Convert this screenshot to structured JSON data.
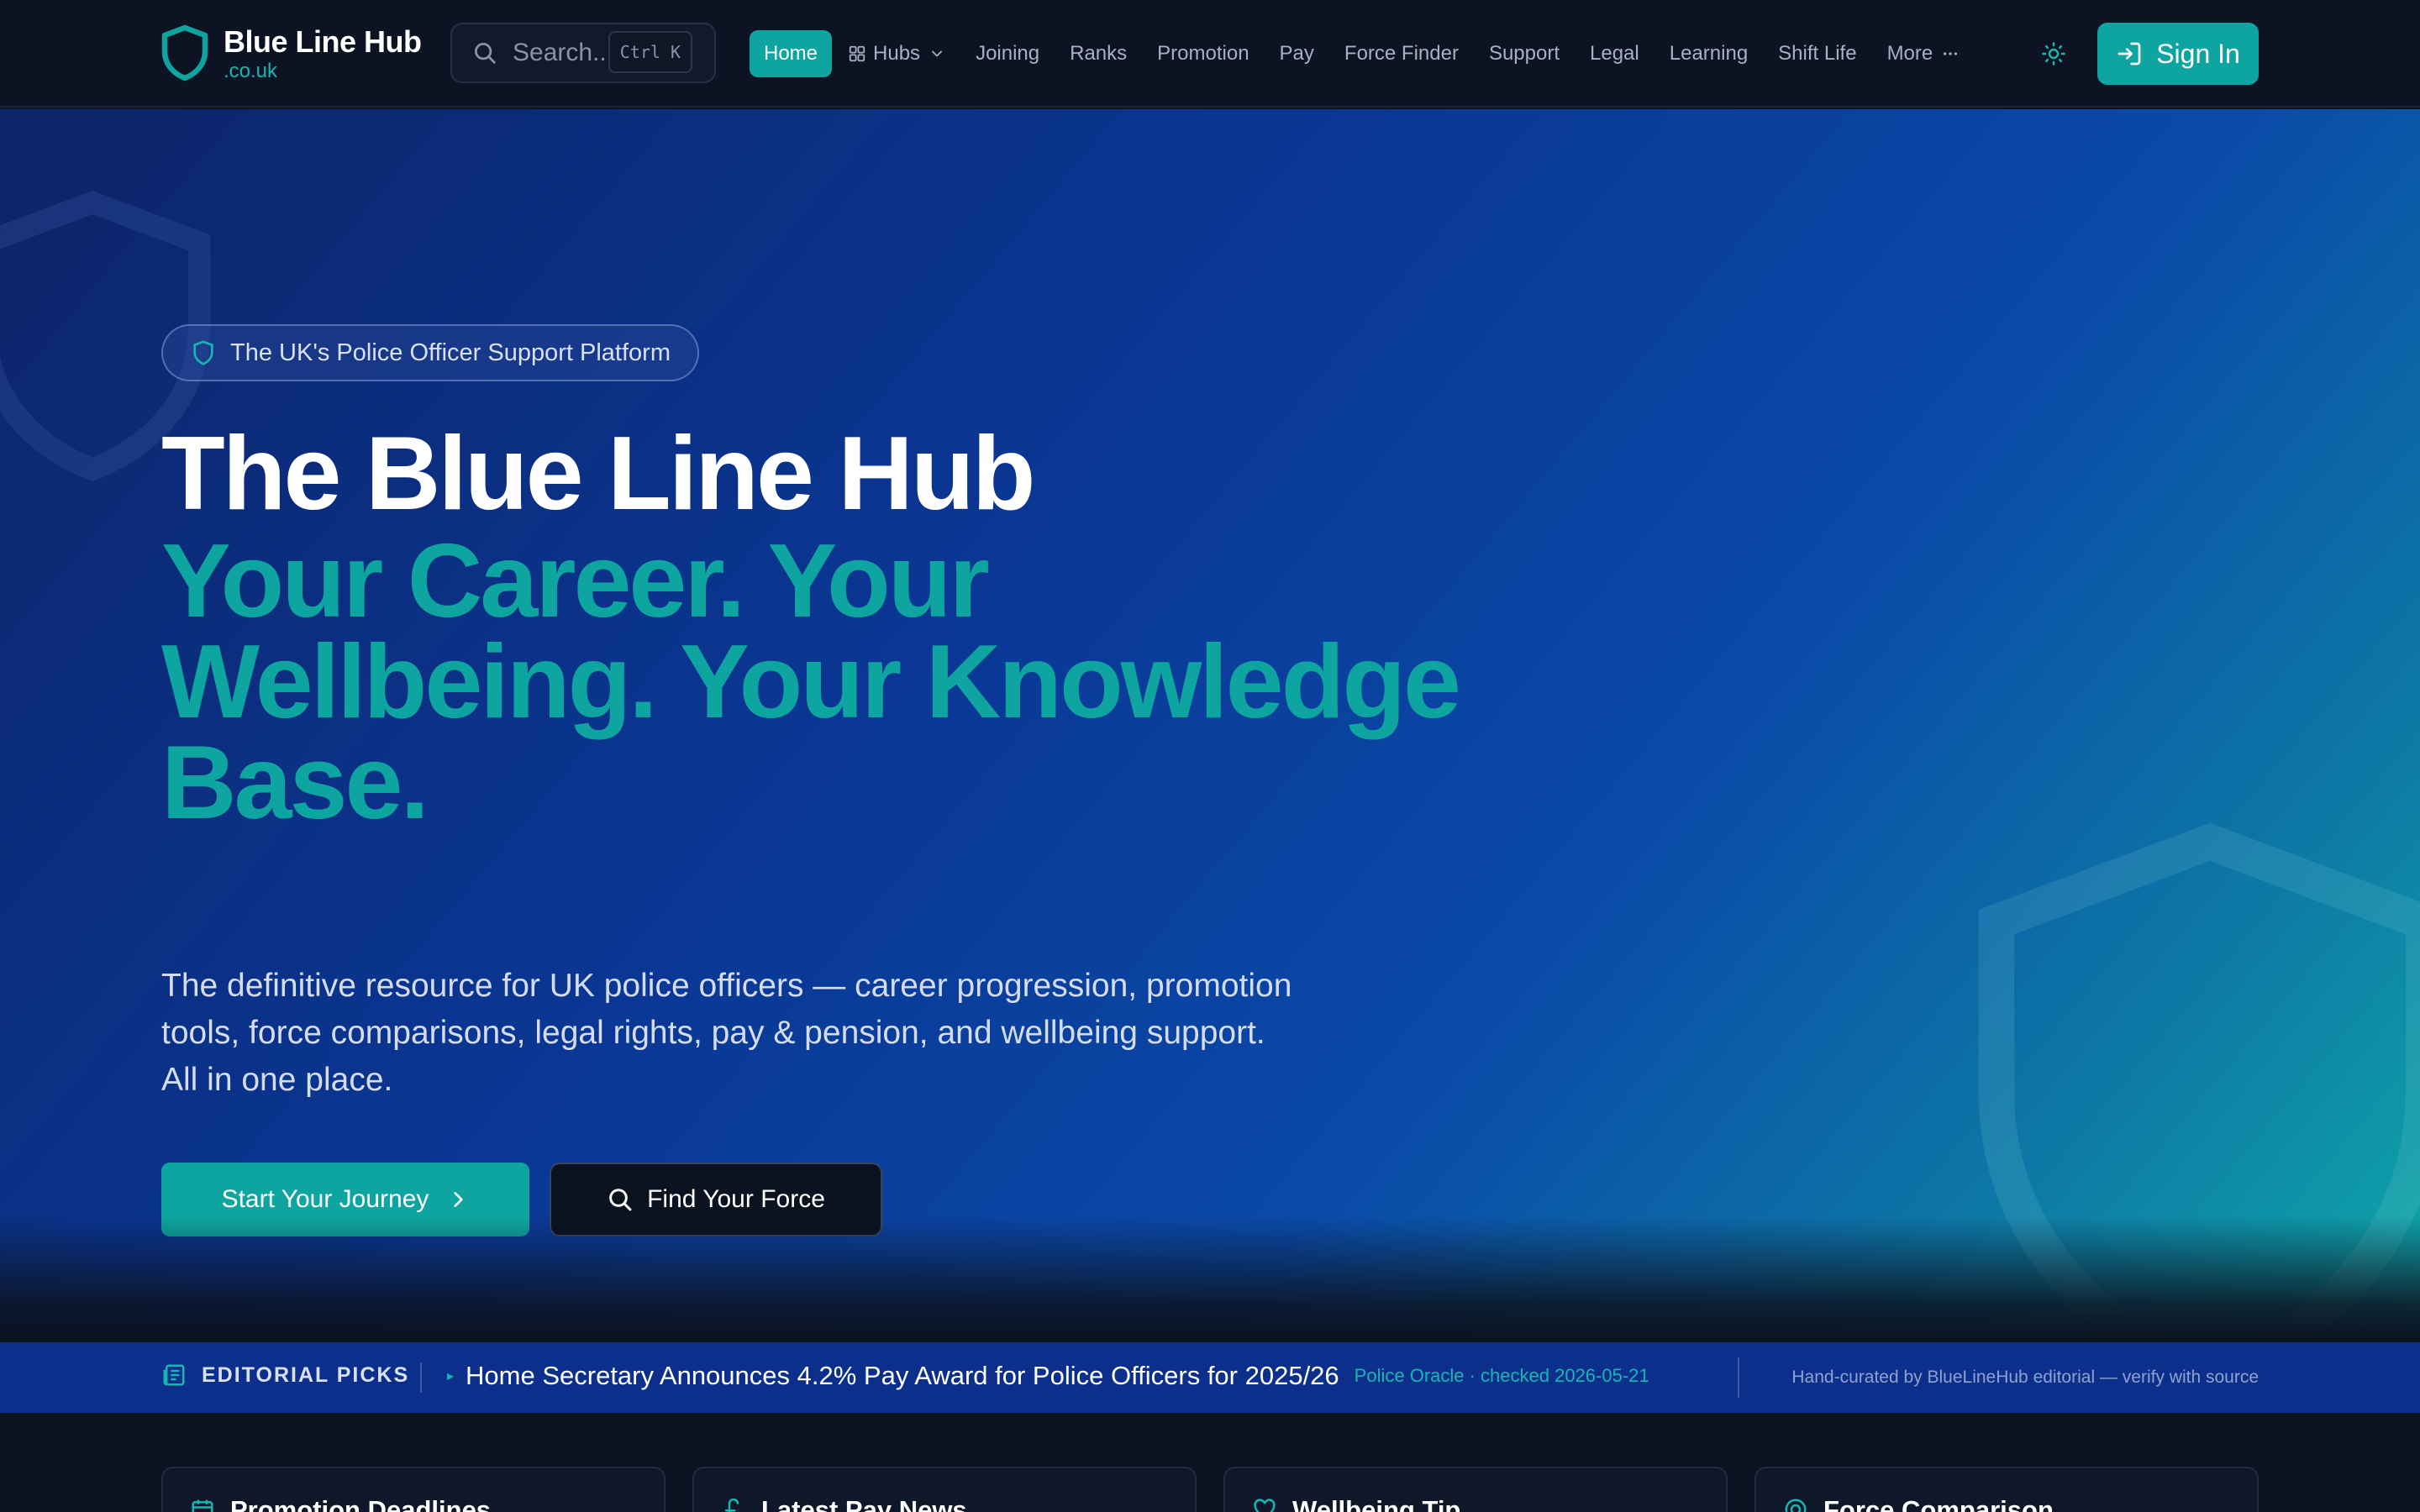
{
  "brand": {
    "name": "Blue Line Hub",
    "domain": ".co.uk",
    "accent": "#0ea5a0"
  },
  "search": {
    "placeholder": "Search...",
    "shortcut": "Ctrl K"
  },
  "nav": {
    "items": [
      {
        "label": "Home",
        "active": true
      },
      {
        "label": "Hubs",
        "icon": "grid-icon",
        "dropdown": true
      },
      {
        "label": "Joining"
      },
      {
        "label": "Ranks"
      },
      {
        "label": "Promotion"
      },
      {
        "label": "Pay"
      },
      {
        "label": "Force Finder"
      },
      {
        "label": "Support"
      },
      {
        "label": "Legal"
      },
      {
        "label": "Learning"
      },
      {
        "label": "Shift Life"
      },
      {
        "label": "More",
        "icon": "ellipsis-icon"
      }
    ],
    "theme_icon": "sun-icon",
    "signin_label": "Sign In"
  },
  "hero": {
    "badge": "The UK's Police Officer Support Platform",
    "title": "The Blue Line Hub",
    "tagline": "Your Career. Your Wellbeing. Your Knowledge Base.",
    "description": "The definitive resource for UK police officers — career progression, promotion tools, force comparisons, legal rights, pay & pension, and wellbeing support. All in one place.",
    "primary_cta": "Start Your Journey",
    "secondary_cta": "Find Your Force"
  },
  "ticker": {
    "label": "EDITORIAL PICKS",
    "headline": "Home Secretary Announces 4.2% Pay Award for Police Officers for 2025/26",
    "source": "Police Oracle · checked 2026-05-21",
    "note": "Hand-curated by BlueLineHub editorial — verify with source"
  },
  "cards": [
    {
      "title": "Promotion Deadlines",
      "icon": "calendar-icon"
    },
    {
      "title": "Latest Pay News",
      "icon": "pound-icon"
    },
    {
      "title": "Wellbeing Tip",
      "icon": "heart-icon"
    },
    {
      "title": "Force Comparison",
      "icon": "target-icon"
    }
  ]
}
